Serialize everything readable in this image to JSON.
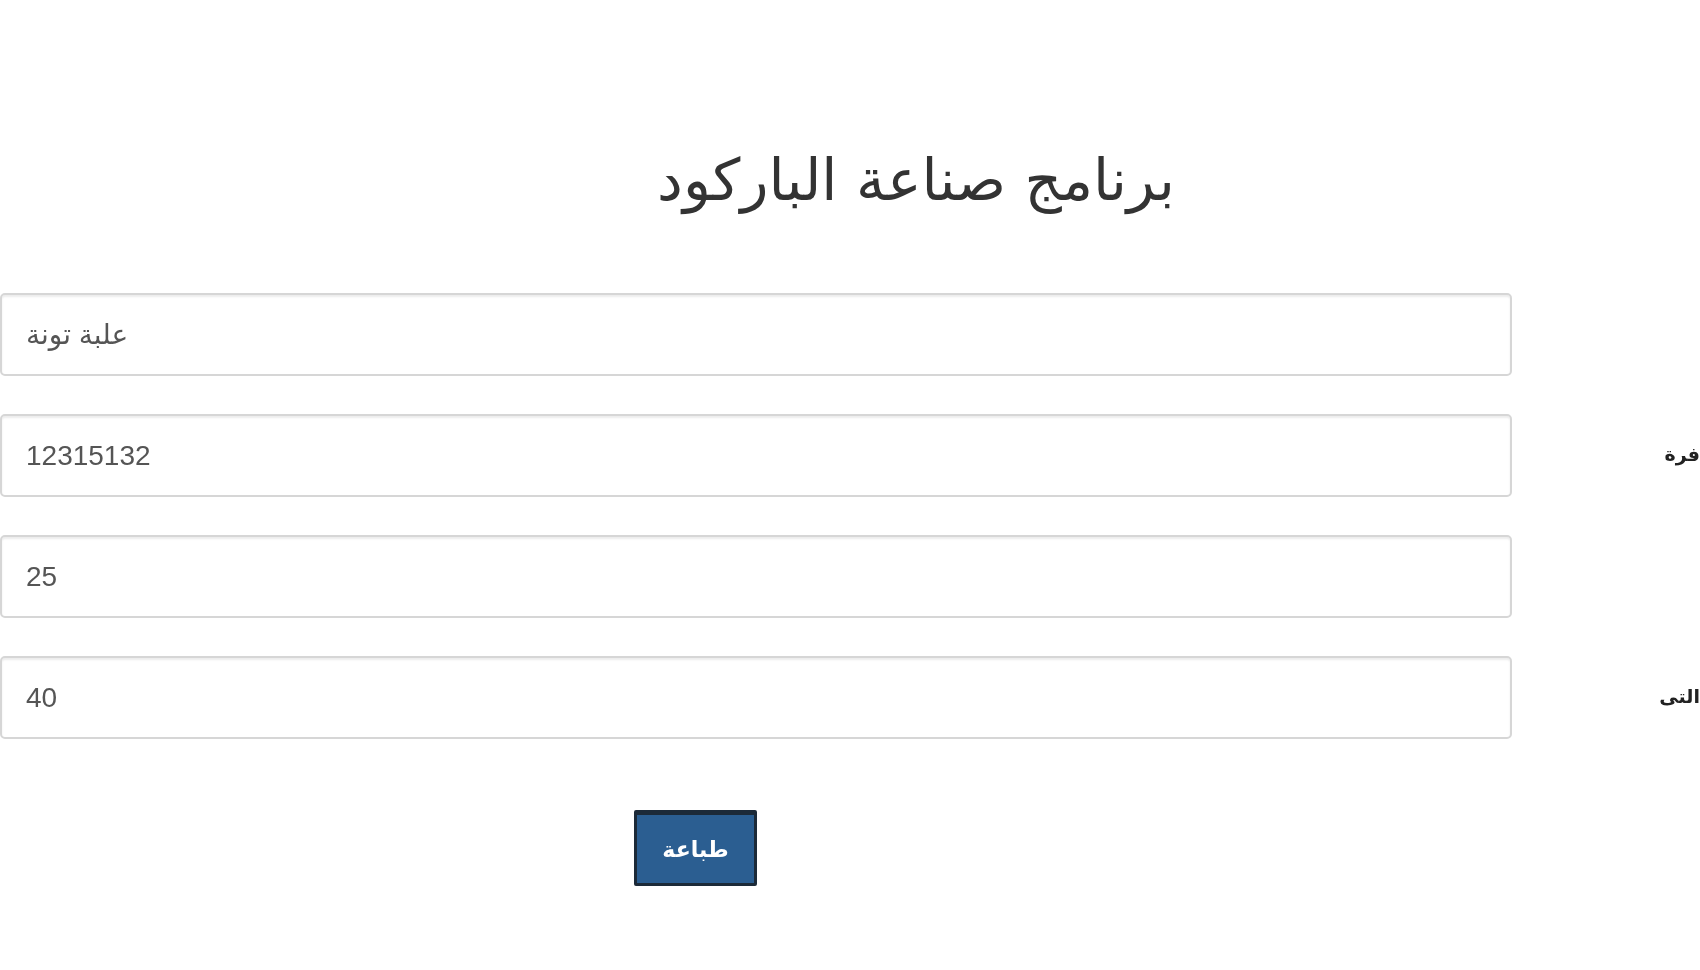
{
  "title": "برنامج صناعة الباركود",
  "fields": [
    {
      "value": "علبة تونة"
    },
    {
      "label": "فرة",
      "value": "12315132"
    },
    {
      "value": "25"
    },
    {
      "label": "التى",
      "value": "40"
    }
  ],
  "print_button": "طباعة"
}
